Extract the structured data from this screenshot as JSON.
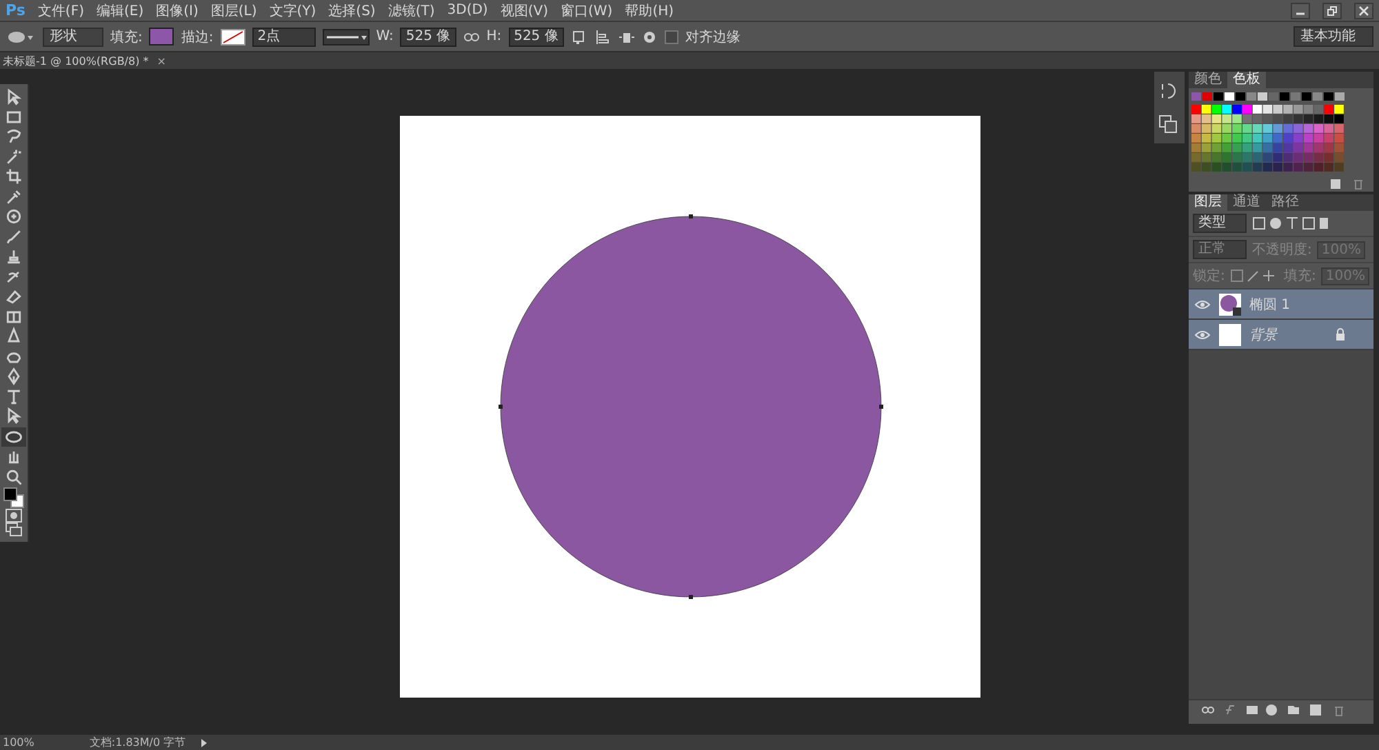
{
  "app_logo": "Ps",
  "menu": [
    "文件(F)",
    "编辑(E)",
    "图像(I)",
    "图层(L)",
    "文字(Y)",
    "选择(S)",
    "滤镜(T)",
    "3D(D)",
    "视图(V)",
    "窗口(W)",
    "帮助(H)"
  ],
  "options_bar": {
    "mode": "形状",
    "fill": {
      "label": "填充:",
      "color": "#8e56a8"
    },
    "stroke": {
      "label": "描边:",
      "width": "2点"
    },
    "w_label": "W:",
    "w_value": "525 像",
    "h_label": "H:",
    "h_value": "525 像",
    "align_edges": {
      "label": "对齐边缘",
      "checked": false
    },
    "workspace": "基本功能"
  },
  "document_tab": {
    "title": "未标题-1 @ 100%(RGB/8) *",
    "close": "×"
  },
  "tools": [
    {
      "kind": "move",
      "selected": false
    },
    {
      "kind": "marquee",
      "selected": false
    },
    {
      "kind": "lasso",
      "selected": false
    },
    {
      "kind": "wand",
      "selected": false
    },
    {
      "kind": "crop",
      "selected": false
    },
    {
      "kind": "eyedropper",
      "selected": false
    },
    {
      "kind": "healing",
      "selected": false
    },
    {
      "kind": "brush",
      "selected": false
    },
    {
      "kind": "stamp",
      "selected": false
    },
    {
      "kind": "history",
      "selected": false
    },
    {
      "kind": "eraser",
      "selected": false
    },
    {
      "kind": "gradient",
      "selected": false
    },
    {
      "kind": "blur",
      "selected": false
    },
    {
      "kind": "dodge",
      "selected": false
    },
    {
      "kind": "pen",
      "selected": false
    },
    {
      "kind": "type",
      "selected": false
    },
    {
      "kind": "path",
      "selected": false
    },
    {
      "kind": "ellipse",
      "selected": true
    },
    {
      "kind": "hand",
      "selected": false
    },
    {
      "kind": "zoom",
      "selected": false
    }
  ],
  "swatches_panel": {
    "tabs": [
      {
        "label": "颜色",
        "selected": false
      },
      {
        "label": "色板",
        "selected": true
      }
    ]
  },
  "layers_panel": {
    "tabs": [
      {
        "label": "图层",
        "selected": true
      },
      {
        "label": "通道",
        "selected": false
      },
      {
        "label": "路径",
        "selected": false
      }
    ],
    "filter": "类型",
    "blend_mode": "正常",
    "opacity_label": "不透明度:",
    "opacity": "100%",
    "lock_label": "锁定:",
    "fill_label": "填充:",
    "fill": "100%",
    "layers": [
      {
        "name": "椭圆 1",
        "kind": "shape",
        "selected": true,
        "visible": true,
        "locked": false
      },
      {
        "name": "背景",
        "kind": "background",
        "selected": true,
        "visible": true,
        "locked": true
      }
    ]
  },
  "status_bar": {
    "zoom": "100%",
    "doc": "文档:1.83M/0 字节"
  }
}
